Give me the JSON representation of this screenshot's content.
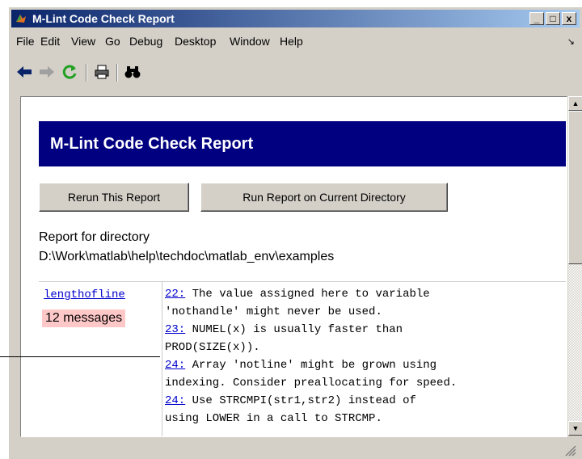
{
  "window": {
    "title": "M-Lint Code Check Report",
    "controls": {
      "minimize": "_",
      "maximize": "□",
      "close": "x"
    }
  },
  "menu": {
    "items": [
      "File",
      "Edit",
      "View",
      "Go",
      "Debug",
      "Desktop",
      "Window",
      "Help"
    ],
    "overflow_arrow": "↘"
  },
  "toolbar": {
    "icons": [
      "back-arrow-icon",
      "forward-arrow-icon",
      "refresh-icon",
      "print-icon",
      "find-binoculars-icon"
    ]
  },
  "report": {
    "heading": "M-Lint Code Check Report",
    "rerun_label": "Rerun This Report",
    "run_current_label": "Run Report on Current Directory",
    "dir_label": "Report for directory",
    "dir_path": "D:\\Work\\matlab\\help\\techdoc\\matlab_env\\examples",
    "file": {
      "name": "lengthofline",
      "count": "12 messages"
    },
    "messages": [
      {
        "line": "22:",
        "text": " The value assigned here to variable\n'nothandle' might never be used."
      },
      {
        "line": "23:",
        "text": " NUMEL(x) is usually faster than\nPROD(SIZE(x))."
      },
      {
        "line": "24:",
        "text": " Array 'notline' might be grown using\nindexing. Consider preallocating for speed."
      },
      {
        "line": "24:",
        "text": " Use STRCMPI(str1,str2) instead of\nusing LOWER in a call to STRCMP."
      }
    ]
  },
  "colors": {
    "banner": "#000080",
    "link": "#0000cc",
    "count_bg": "#ffc8c8",
    "titlebar": "#0a246a"
  }
}
